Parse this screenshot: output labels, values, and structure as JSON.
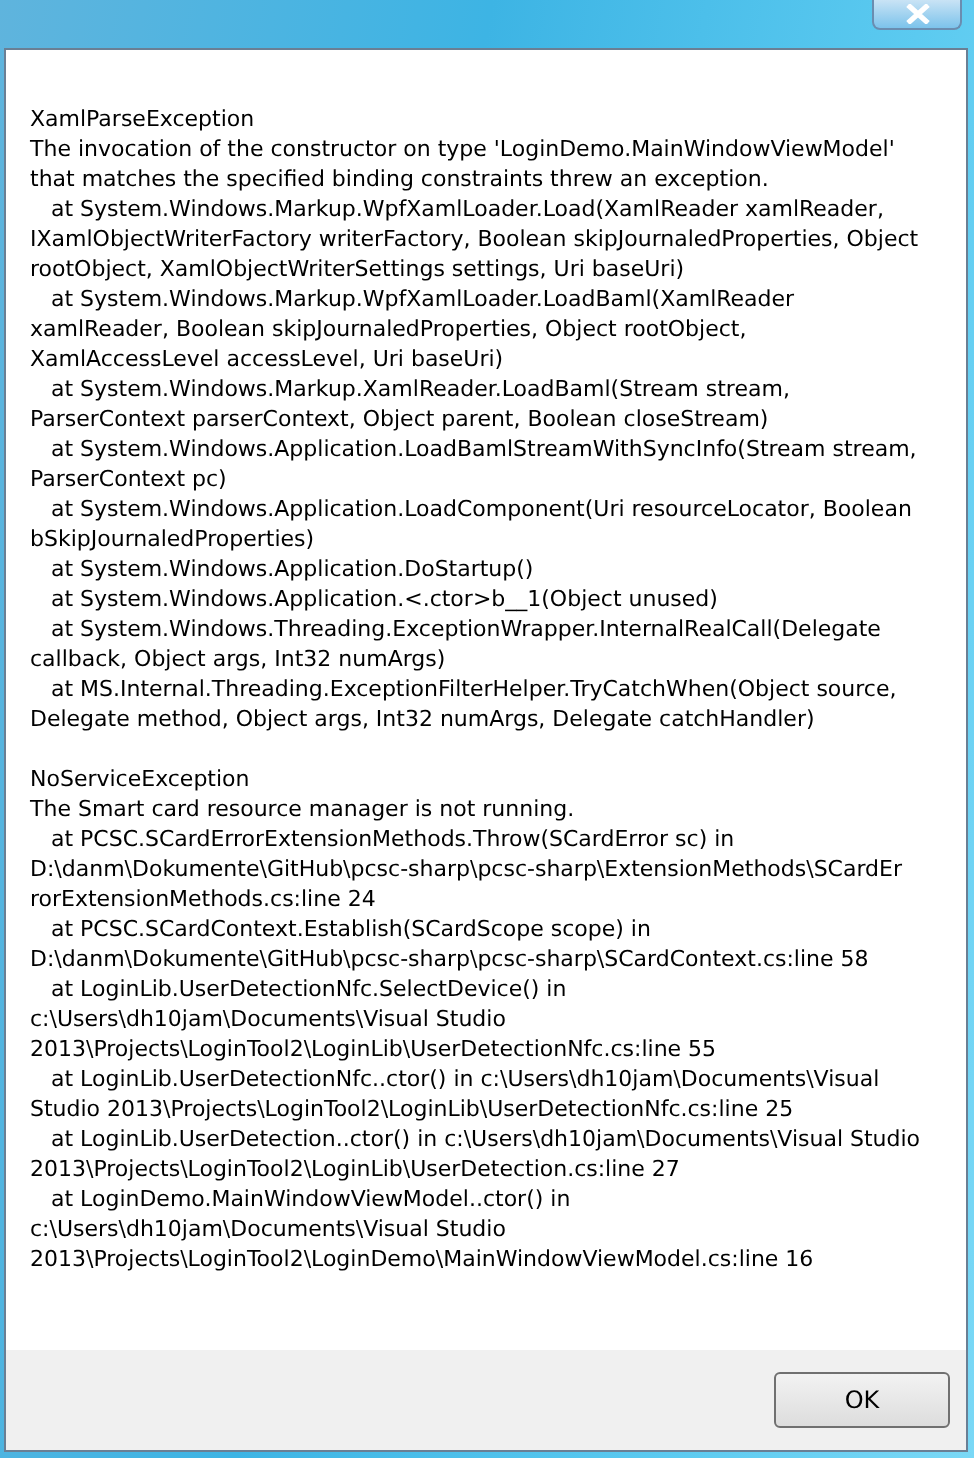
{
  "message": {
    "sections": [
      {
        "lines": [
          "XamlParseException",
          "The invocation of the constructor on type 'LoginDemo.MainWindowViewModel'",
          "that matches the specified binding constraints threw an exception.",
          "   at System.Windows.Markup.WpfXamlLoader.Load(XamlReader xamlReader,",
          "IXamlObjectWriterFactory writerFactory, Boolean skipJournaledProperties, Object",
          "rootObject, XamlObjectWriterSettings settings, Uri baseUri)",
          "   at System.Windows.Markup.WpfXamlLoader.LoadBaml(XamlReader",
          "xamlReader, Boolean skipJournaledProperties, Object rootObject,",
          "XamlAccessLevel accessLevel, Uri baseUri)",
          "   at System.Windows.Markup.XamlReader.LoadBaml(Stream stream,",
          "ParserContext parserContext, Object parent, Boolean closeStream)",
          "   at System.Windows.Application.LoadBamlStreamWithSyncInfo(Stream stream,",
          "ParserContext pc)",
          "   at System.Windows.Application.LoadComponent(Uri resourceLocator, Boolean",
          "bSkipJournaledProperties)",
          "   at System.Windows.Application.DoStartup()",
          "   at System.Windows.Application.<.ctor>b__1(Object unused)",
          "   at System.Windows.Threading.ExceptionWrapper.InternalRealCall(Delegate",
          "callback, Object args, Int32 numArgs)",
          "   at MS.Internal.Threading.ExceptionFilterHelper.TryCatchWhen(Object source,",
          "Delegate method, Object args, Int32 numArgs, Delegate catchHandler)"
        ]
      },
      {
        "lines": [
          "NoServiceException",
          "The Smart card resource manager is not running.",
          "   at PCSC.SCardErrorExtensionMethods.Throw(SCardError sc) in",
          "D:\\danm\\Dokumente\\GitHub\\pcsc-sharp\\pcsc-sharp\\ExtensionMethods\\SCardEr",
          "rorExtensionMethods.cs:line 24",
          "   at PCSC.SCardContext.Establish(SCardScope scope) in",
          "D:\\danm\\Dokumente\\GitHub\\pcsc-sharp\\pcsc-sharp\\SCardContext.cs:line 58",
          "   at LoginLib.UserDetectionNfc.SelectDevice() in",
          "c:\\Users\\dh10jam\\Documents\\Visual Studio",
          "2013\\Projects\\LoginTool2\\LoginLib\\UserDetectionNfc.cs:line 55",
          "   at LoginLib.UserDetectionNfc..ctor() in c:\\Users\\dh10jam\\Documents\\Visual",
          "Studio 2013\\Projects\\LoginTool2\\LoginLib\\UserDetectionNfc.cs:line 25",
          "   at LoginLib.UserDetection..ctor() in c:\\Users\\dh10jam\\Documents\\Visual Studio",
          "2013\\Projects\\LoginTool2\\LoginLib\\UserDetection.cs:line 27",
          "   at LoginDemo.MainWindowViewModel..ctor() in",
          "c:\\Users\\dh10jam\\Documents\\Visual Studio",
          "2013\\Projects\\LoginTool2\\LoginDemo\\MainWindowViewModel.cs:line 16"
        ]
      }
    ]
  },
  "buttons": [
    {
      "label": "OK"
    }
  ]
}
